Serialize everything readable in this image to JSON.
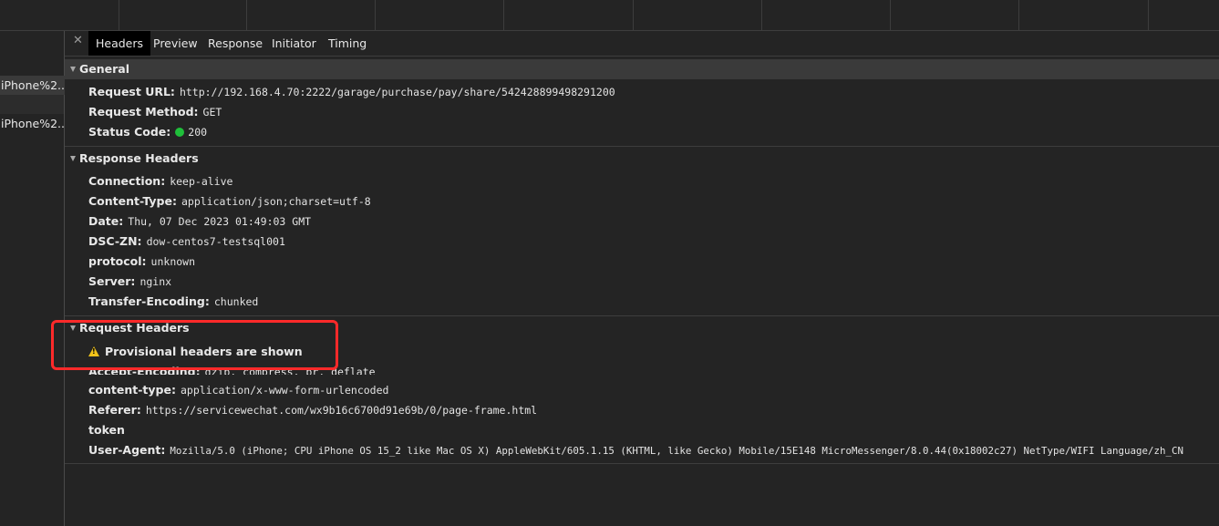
{
  "tabs": [
    "Headers",
    "Preview",
    "Response",
    "Initiator",
    "Timing"
  ],
  "requests": [
    {
      "label": "iPhone%2..."
    },
    {
      "label": "iPhone%2..."
    }
  ],
  "general": {
    "title": "General",
    "rows": [
      {
        "key": "Request URL:",
        "value": "http://192.168.4.70:2222/garage/purchase/pay/share/542428899498291200"
      },
      {
        "key": "Request Method:",
        "value": "GET"
      },
      {
        "key": "Status Code:",
        "value": "200"
      }
    ]
  },
  "response_headers": {
    "title": "Response Headers",
    "rows": [
      {
        "key": "Connection:",
        "value": "keep-alive"
      },
      {
        "key": "Content-Type:",
        "value": "application/json;charset=utf-8"
      },
      {
        "key": "Date:",
        "value": "Thu, 07 Dec 2023 01:49:03 GMT"
      },
      {
        "key": "DSC-ZN:",
        "value": "dow-centos7-testsql001"
      },
      {
        "key": "protocol:",
        "value": "unknown"
      },
      {
        "key": "Server:",
        "value": "nginx"
      },
      {
        "key": "Transfer-Encoding:",
        "value": "chunked"
      }
    ]
  },
  "request_headers": {
    "title": "Request Headers",
    "warning": "Provisional headers are shown",
    "partial_row": {
      "key": "Accept-Encoding:",
      "value": "gzip, compress, br, deflate"
    },
    "rows": [
      {
        "key": "content-type:",
        "value": "application/x-www-form-urlencoded"
      },
      {
        "key": "Referer:",
        "value": "https://servicewechat.com/wx9b16c6700d91e69b/0/page-frame.html"
      },
      {
        "key": "token",
        "value": ""
      },
      {
        "key": "User-Agent:",
        "value": "Mozilla/5.0 (iPhone; CPU iPhone OS 15_2 like Mac OS X) AppleWebKit/605.1.15 (KHTML, like Gecko) Mobile/15E148 MicroMessenger/8.0.44(0x18002c27) NetType/WIFI Language/zh_CN"
      }
    ]
  },
  "colors": {
    "status_ok": "#1fbf3a",
    "highlight_box": "#ff2a2a",
    "warning": "#f2c31a"
  }
}
